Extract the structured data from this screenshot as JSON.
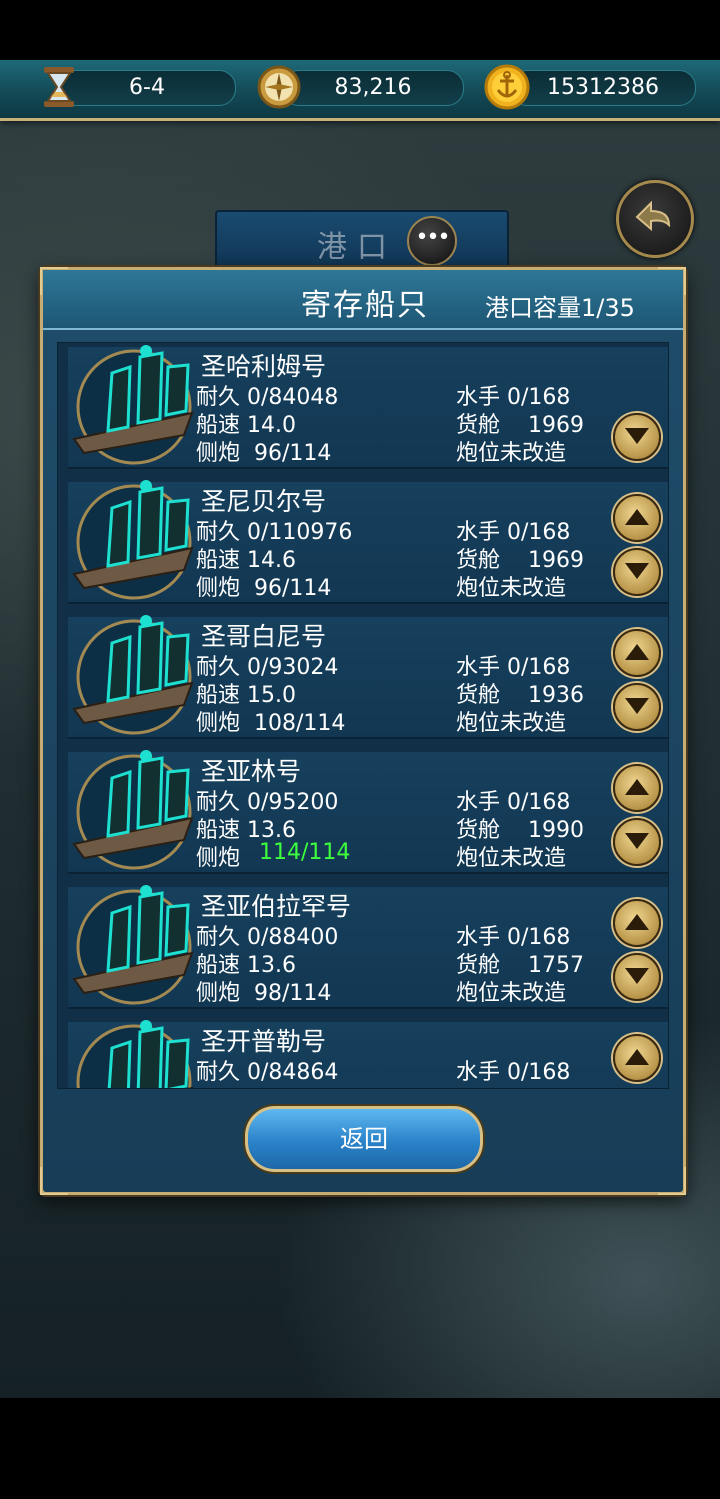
{
  "topbar": {
    "level": "6-4",
    "exploration": "83,216",
    "gold": "15312386",
    "icons": [
      "hourglass-icon",
      "compass-icon",
      "gold-anchor-coin-icon"
    ]
  },
  "background": {
    "port_title": "港口"
  },
  "panel": {
    "title": "寄存船只",
    "capacity": "港口容量1/35",
    "return_label": "返回"
  },
  "ships": [
    {
      "name": "圣哈利姆号",
      "durability": "耐久 0/84048",
      "speed": "船速 14.0",
      "cannon": "侧炮  96/114",
      "cannon_highlight": false,
      "sailors": "水手 0/168",
      "cargo": "货舱    1969",
      "gun_slot": "炮位未改造"
    },
    {
      "name": "圣尼贝尔号",
      "durability": "耐久 0/110976",
      "speed": "船速 14.6",
      "cannon": "侧炮  96/114",
      "cannon_highlight": false,
      "sailors": "水手 0/168",
      "cargo": "货舱    1969",
      "gun_slot": "炮位未改造"
    },
    {
      "name": "圣哥白尼号",
      "durability": "耐久 0/93024",
      "speed": "船速 15.0",
      "cannon": "侧炮  108/114",
      "cannon_highlight": false,
      "sailors": "水手 0/168",
      "cargo": "货舱    1936",
      "gun_slot": "炮位未改造"
    },
    {
      "name": "圣亚林号",
      "durability": "耐久 0/95200",
      "speed": "船速 13.6",
      "cannon_label": "侧炮",
      "cannon_value": "114/114",
      "cannon_highlight": true,
      "sailors": "水手 0/168",
      "cargo": "货舱    1990",
      "gun_slot": "炮位未改造"
    },
    {
      "name": "圣亚伯拉罕号",
      "durability": "耐久 0/88400",
      "speed": "船速 13.6",
      "cannon": "侧炮  98/114",
      "cannon_highlight": false,
      "sailors": "水手 0/168",
      "cargo": "货舱    1757",
      "gun_slot": "炮位未改造"
    },
    {
      "name": "圣开普勒号",
      "durability": "耐久 0/84864",
      "sailors": "水手 0/168"
    }
  ],
  "colors": {
    "highlight_green": "#3dff3d",
    "panel_border": "#c7ad74",
    "button_gold": "#d9c089"
  }
}
